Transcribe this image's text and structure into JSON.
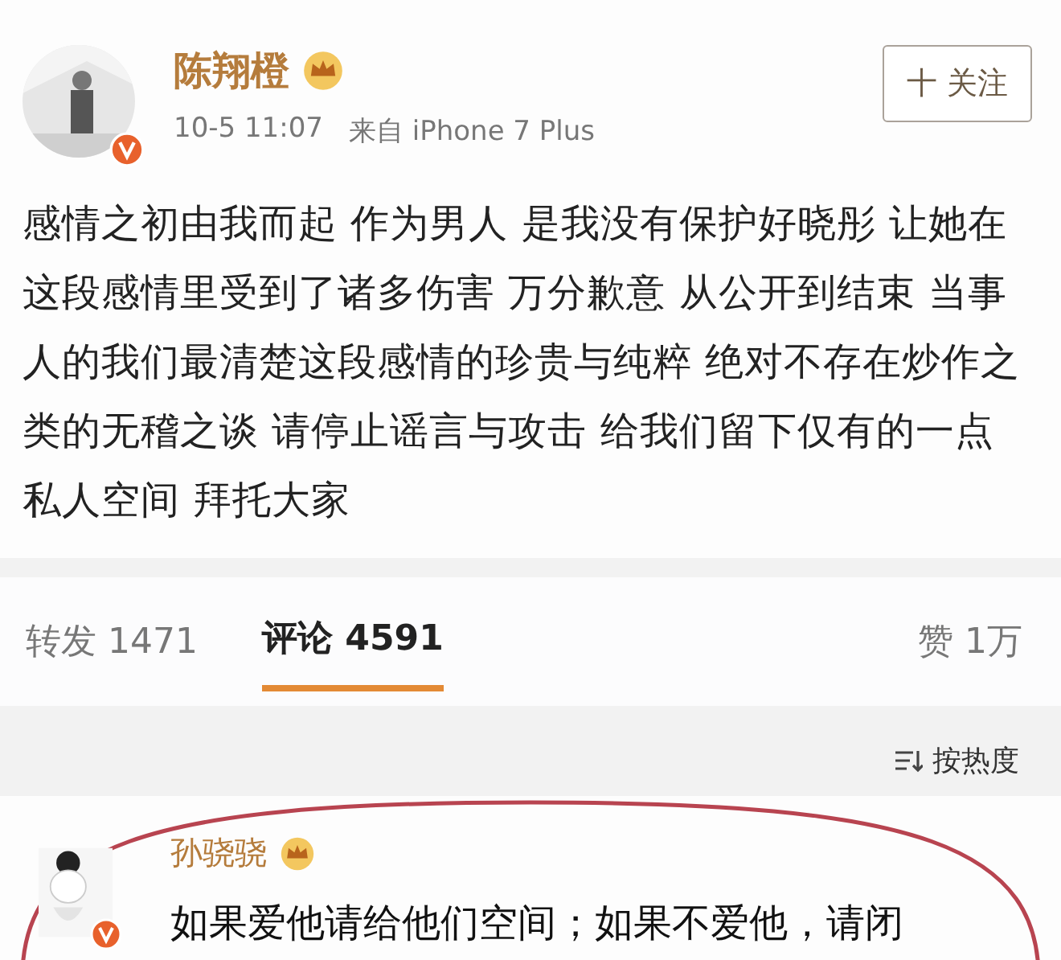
{
  "post": {
    "author": "陈翔橙",
    "time": "10-5 11:07",
    "source": "来自 iPhone 7 Plus",
    "follow_button": "十 关注",
    "text": "感情之初由我而起 作为男人 是我没有保护好晓彤 让她在这段感情里受到了诸多伤害 万分歉意 从公开到结束 当事人的我们最清楚这段感情的珍贵与纯粹 绝对不存在炒作之类的无稽之谈 请停止谣言与攻击 给我们留下仅有的一点私人空间 拜托大家"
  },
  "tabs": [
    {
      "label": "转发 1471",
      "selected": false
    },
    {
      "label": "评论 4591",
      "selected": true
    }
  ],
  "likes": "赞 1万",
  "sort": "按热度",
  "comments": [
    {
      "author": "孙骁骁",
      "text": "如果爱他请给他们空间；如果不爱他，请闭",
      "highlighted": true
    }
  ]
}
